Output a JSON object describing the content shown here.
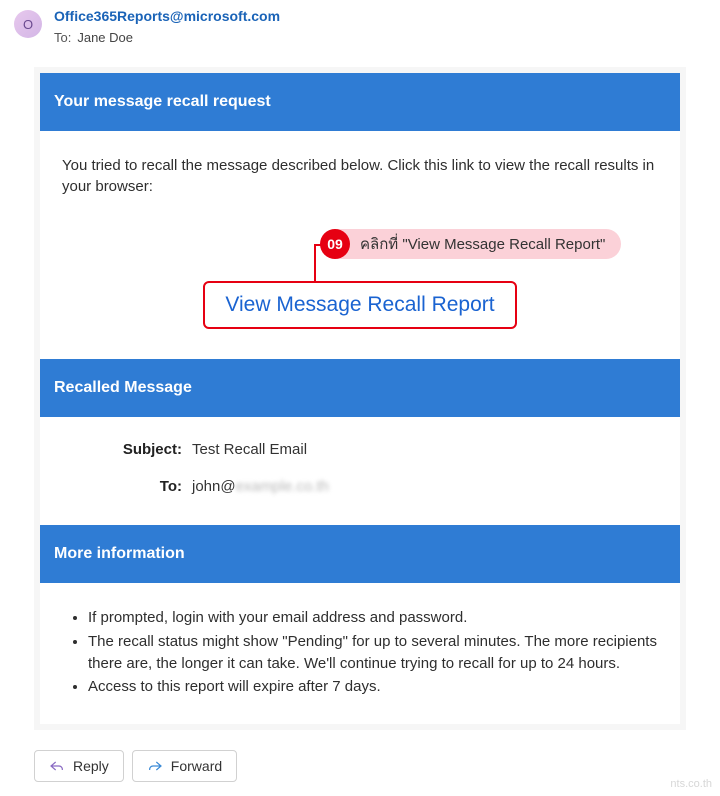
{
  "header": {
    "avatar_initial": "O",
    "from": "Office365Reports@microsoft.com",
    "to_label": "To:",
    "to_value": "Jane Doe"
  },
  "sections": {
    "recall_request": {
      "title": "Your message recall request",
      "intro": "You tried to recall the message described below. Click this link to view the recall results in your browser:",
      "callout_num": "09",
      "callout_text": "คลิกที่ \"View Message Recall Report\"",
      "link_text": "View Message Recall Report"
    },
    "recalled_message": {
      "title": "Recalled Message",
      "subject_label": "Subject:",
      "subject_value": "Test Recall Email",
      "to_label": "To:",
      "to_value_visible": "john@",
      "to_value_hidden": "example.co.th"
    },
    "more_info": {
      "title": "More information",
      "items": [
        "If prompted, login with your email address and password.",
        "The recall status might show \"Pending\" for up to several minutes. The more recipients there are, the longer it can take. We'll continue trying to recall for up to 24 hours.",
        "Access to this report will expire after 7 days."
      ]
    }
  },
  "actions": {
    "reply": "Reply",
    "forward": "Forward"
  },
  "watermark": "nts.co.th"
}
